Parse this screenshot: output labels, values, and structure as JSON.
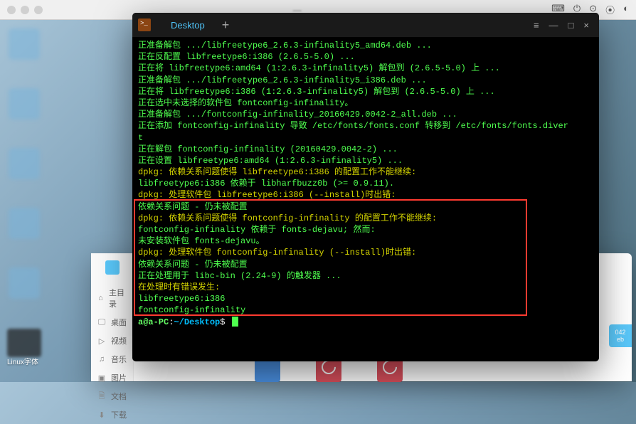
{
  "mac": {
    "title": "— "
  },
  "menubar": {
    "icons": [
      "⌨",
      "⏻",
      "⊙",
      "⏻",
      "◐"
    ]
  },
  "desktop": {
    "label": "Linux字体"
  },
  "filemanager": {
    "sidebar": {
      "items": [
        {
          "icon": "⌂",
          "label": "主目录"
        },
        {
          "icon": "🖵",
          "label": "桌面"
        },
        {
          "icon": "▷",
          "label": "视频"
        },
        {
          "icon": "♫",
          "label": "音乐"
        },
        {
          "icon": "▣",
          "label": "图片"
        },
        {
          "icon": "🗎",
          "label": "文档"
        },
        {
          "icon": "⬇",
          "label": "下载"
        }
      ]
    },
    "badge": {
      "l1": "042",
      "l2": "eb"
    }
  },
  "terminal": {
    "tab": "Desktop",
    "new_tab": "+",
    "controls": {
      "menu": "≡",
      "min": "—",
      "max": "□",
      "close": "×"
    },
    "lines": [
      "正准备解包 .../libfreetype6_2.6.3-infinality5_amd64.deb  ...",
      "正在反配置 libfreetype6:i386 (2.6.5-5.0) ...",
      "正在将 libfreetype6:amd64 (1:2.6.3-infinality5) 解包到 (2.6.5-5.0) 上 ...",
      "正准备解包 .../libfreetype6_2.6.3-infinality5_i386.deb  ...",
      "正在将 libfreetype6:i386 (1:2.6.3-infinality5) 解包到 (2.6.5-5.0) 上 ...",
      "正在选中未选择的软件包 fontconfig-infinality。",
      "正准备解包 .../fontconfig-infinality_20160429.0042-2_all.deb  ...",
      "正在添加 fontconfig-infinality 导致 /etc/fonts/fonts.conf 转移到 /etc/fonts/fonts.diver",
      "t",
      "正在解包 fontconfig-infinality (20160429.0042-2) ...",
      "正在设置 libfreetype6:amd64 (1:2.6.3-infinality5) ...",
      "dpkg: 依赖关系问题使得 libfreetype6:i386 的配置工作不能继续:",
      " libfreetype6:i386 依赖于 libharfbuzz0b (>= 0.9.11).",
      "",
      "dpkg: 处理软件包 libfreetype6:i386 (--install)时出错:",
      " 依赖关系问题 - 仍未被配置",
      "dpkg: 依赖关系问题使得 fontconfig-infinality 的配置工作不能继续:",
      " fontconfig-infinality 依赖于 fonts-dejavu; 然而:",
      "  未安装软件包 fonts-dejavu。",
      "",
      "dpkg: 处理软件包 fontconfig-infinality (--install)时出错:",
      " 依赖关系问题 - 仍未被配置",
      "正在处理用于 libc-bin (2.24-9) 的触发器 ...",
      "在处理时有错误发生:",
      " libfreetype6:i386",
      " fontconfig-infinality"
    ],
    "prompt": {
      "user": "a@a-PC",
      "sep": ":",
      "path": "~/Desktop",
      "sym": "$"
    }
  }
}
